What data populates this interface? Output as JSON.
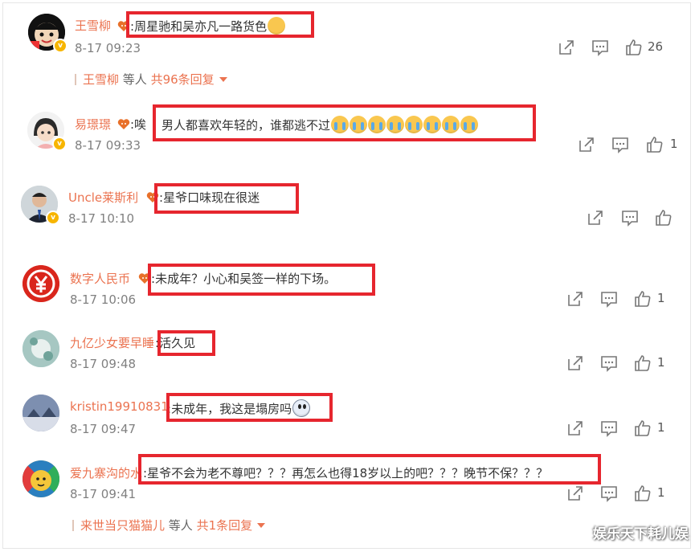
{
  "comments": [
    {
      "name": "王雪柳",
      "sep": ":",
      "text": "周星驰和吴亦凡一路货色",
      "time": "8-17 09:23",
      "likes": "26",
      "reply": {
        "user": "王雪柳",
        "mid": " 等人 ",
        "total": "共96条回复"
      }
    },
    {
      "name": "易璟璟",
      "sep": ":唉",
      "text": "男人都喜欢年轻的，谁都逃不过",
      "time": "8-17 09:33",
      "likes": "1"
    },
    {
      "name": "Uncle莱斯利",
      "sep": ":",
      "text": "星爷口味现在很迷",
      "time": "8-17 10:10",
      "likes": ""
    },
    {
      "name": "数字人民币",
      "sep": ":",
      "text": "未成年？小心和吴签一样的下场。",
      "time": "8-17 10:06",
      "likes": "1"
    },
    {
      "name": "九亿少女要早睡",
      "sep": ":",
      "text": "活久见",
      "time": "8-17 09:48",
      "likes": "1"
    },
    {
      "name": "kristin19910831",
      "sep": ":",
      "text": "未成年，我这是塌房吗",
      "time": "8-17 09:47",
      "likes": "1"
    },
    {
      "name": "爱九寨沟的水",
      "sep": ":",
      "text": "星爷不会为老不尊吧？？？再怎么也得18岁以上的吧？？？晚节不保？？？",
      "time": "8-17 09:41",
      "likes": "1",
      "reply": {
        "user": "来世当只猫猫儿",
        "mid": " 等人 ",
        "total": "共1条回复"
      }
    }
  ],
  "icons": {
    "share": "share-icon",
    "comment": "comment-icon",
    "like": "like-icon",
    "badge": "heart-badge-icon",
    "verified": "verified-badge-icon"
  },
  "colors": {
    "name": "#eb7350",
    "highlight": "#e6262e",
    "time": "#808080"
  },
  "watermark": "娱乐天下耗儿娱"
}
